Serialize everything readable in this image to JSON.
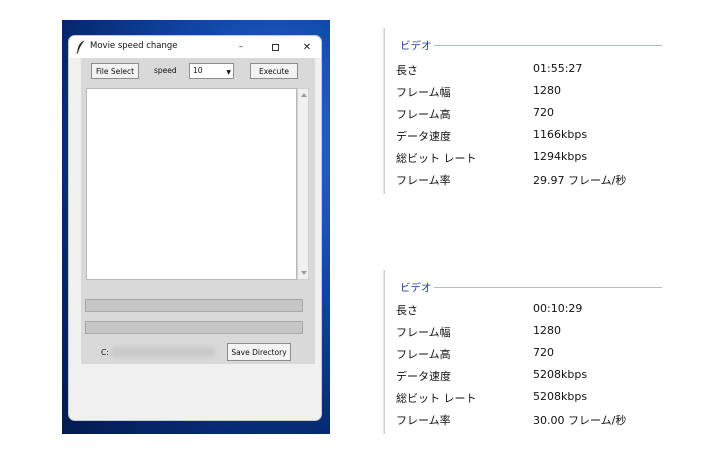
{
  "window": {
    "title": "Movie speed change",
    "minimize_glyph": "–",
    "close_glyph": "✕",
    "file_select_label": "File Select",
    "speed_label": "speed",
    "speed_value": "10",
    "execute_label": "Execute",
    "path_prefix": "C:",
    "save_directory_label": "Save Directory"
  },
  "panels": [
    {
      "section": "ビデオ",
      "rows": [
        {
          "key": "長さ",
          "value": "01:55:27"
        },
        {
          "key": "フレーム幅",
          "value": "1280"
        },
        {
          "key": "フレーム高",
          "value": "720"
        },
        {
          "key": "データ速度",
          "value": "1166kbps"
        },
        {
          "key": "総ビット レート",
          "value": "1294kbps"
        },
        {
          "key": "フレーム率",
          "value": "29.97 フレーム/秒"
        }
      ]
    },
    {
      "section": "ビデオ",
      "rows": [
        {
          "key": "長さ",
          "value": "00:10:29"
        },
        {
          "key": "フレーム幅",
          "value": "1280"
        },
        {
          "key": "フレーム高",
          "value": "720"
        },
        {
          "key": "データ速度",
          "value": "5208kbps"
        },
        {
          "key": "総ビット レート",
          "value": "5208kbps"
        },
        {
          "key": "フレーム率",
          "value": "30.00 フレーム/秒"
        }
      ]
    }
  ],
  "colors": {
    "section_title": "#1e3f9e",
    "desktop": "#0f4aa8",
    "progress_track": "#c6c6c6"
  },
  "icons": [
    "feather-icon",
    "minimize-icon",
    "maximize-icon",
    "close-icon",
    "dropdown-arrow-icon",
    "scroll-up-icon",
    "scroll-down-icon"
  ]
}
